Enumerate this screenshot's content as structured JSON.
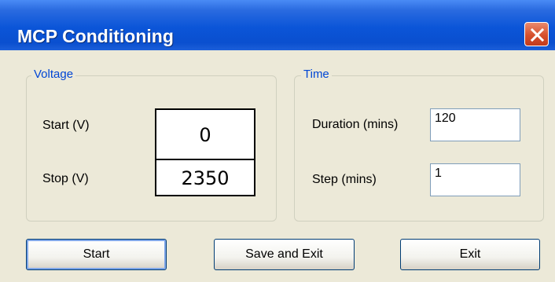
{
  "window": {
    "title": "MCP Conditioning"
  },
  "voltage": {
    "group_label": "Voltage",
    "start_label": "Start (V)",
    "start_value": "0",
    "stop_label": "Stop (V)",
    "stop_value": "2350"
  },
  "time": {
    "group_label": "Time",
    "duration_label": "Duration (mins)",
    "duration_value": "120",
    "step_label": "Step (mins)",
    "step_value": "1"
  },
  "buttons": {
    "start_label": "Start",
    "save_exit_label": "Save and Exit",
    "exit_label": "Exit"
  },
  "colors": {
    "titlebar": "#0b55d8",
    "close_button": "#d6502d",
    "dialog_background": "#ece9d8",
    "group_title": "#0046d5"
  }
}
